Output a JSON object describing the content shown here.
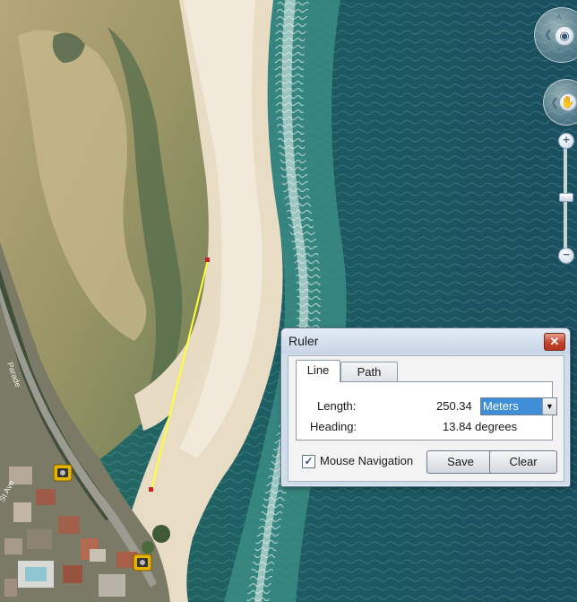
{
  "map": {
    "street_labels": [
      "Parade",
      "St Ave"
    ],
    "measure_line_color": "#ffff33",
    "measure_point_color": "#cc2222"
  },
  "navigation": {
    "look_icon": "eye-icon",
    "move_icon": "hand-icon",
    "zoom_in_label": "+",
    "zoom_out_label": "−"
  },
  "ruler": {
    "title": "Ruler",
    "close_label": "✕",
    "tabs": [
      {
        "label": "Line",
        "active": true
      },
      {
        "label": "Path",
        "active": false
      }
    ],
    "length_label": "Length:",
    "length_value": "250.34",
    "length_unit": "Meters",
    "heading_label": "Heading:",
    "heading_value": "13.84 degrees",
    "mouse_navigation_label": "Mouse Navigation",
    "mouse_navigation_checked": true,
    "check_mark": "✓",
    "dropdown_arrow": "▼",
    "save_label": "Save",
    "clear_label": "Clear"
  },
  "colors": {
    "dialog_frame": "#cfdce9",
    "selection_blue": "#3e8ed8"
  }
}
